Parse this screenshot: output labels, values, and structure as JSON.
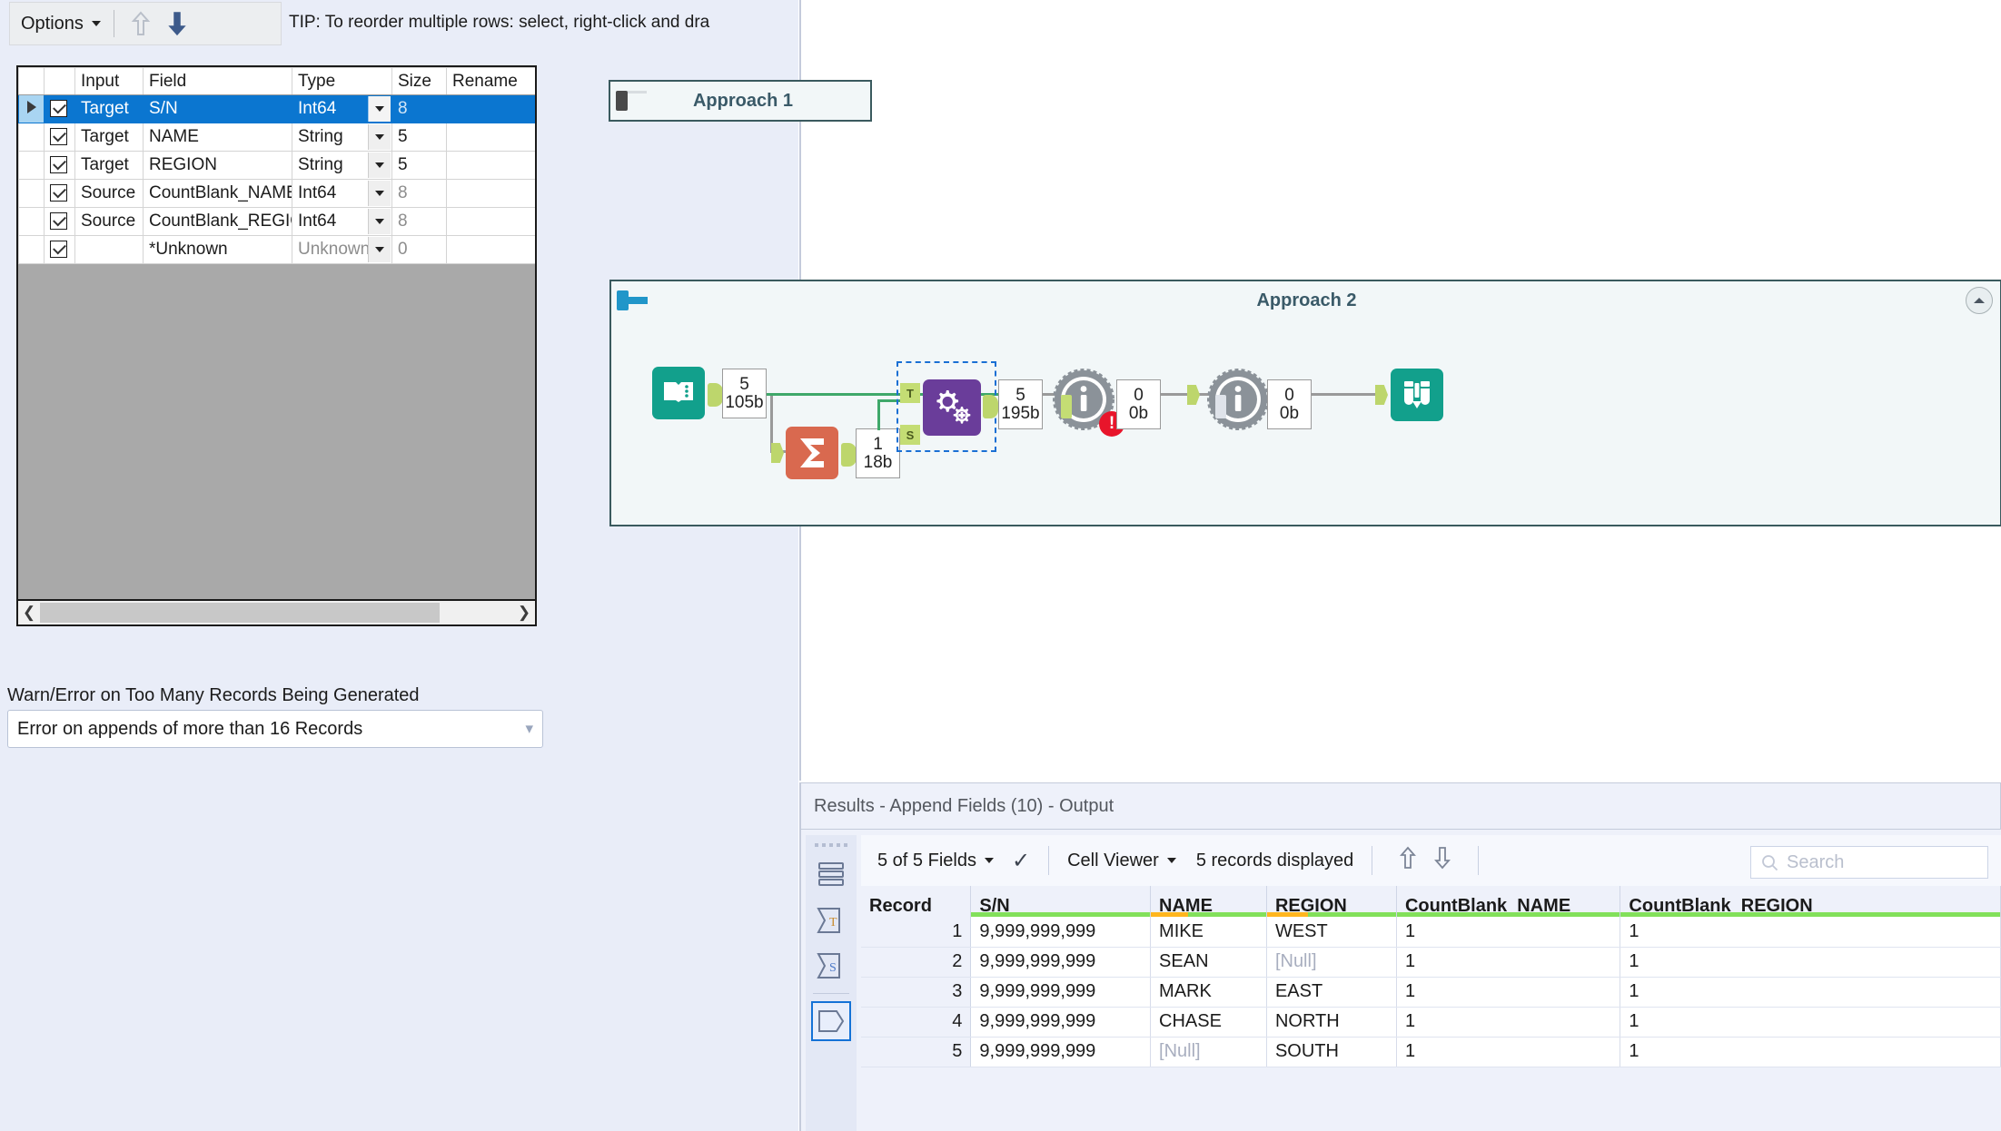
{
  "config_panel": {
    "toolbar": {
      "options_label": "Options",
      "move_up_icon": "arrow-up-icon",
      "move_down_icon": "arrow-down-icon",
      "tip": "TIP: To reorder multiple rows: select, right-click and dra"
    },
    "grid": {
      "columns": [
        "Input",
        "Field",
        "Type",
        "Size",
        "Rename"
      ],
      "rows": [
        {
          "selected": true,
          "checked": true,
          "input": "Target",
          "field": "S/N",
          "type": "Int64",
          "type_dim": false,
          "size": "8",
          "size_dim": true,
          "rename": ""
        },
        {
          "selected": false,
          "checked": true,
          "input": "Target",
          "field": "NAME",
          "type": "String",
          "type_dim": false,
          "size": "5",
          "size_dim": false,
          "rename": ""
        },
        {
          "selected": false,
          "checked": true,
          "input": "Target",
          "field": "REGION",
          "type": "String",
          "type_dim": false,
          "size": "5",
          "size_dim": false,
          "rename": ""
        },
        {
          "selected": false,
          "checked": true,
          "input": "Source",
          "field": "CountBlank_NAME",
          "type": "Int64",
          "type_dim": false,
          "size": "8",
          "size_dim": true,
          "rename": ""
        },
        {
          "selected": false,
          "checked": true,
          "input": "Source",
          "field": "CountBlank_REGION",
          "type": "Int64",
          "type_dim": false,
          "size": "8",
          "size_dim": true,
          "rename": ""
        },
        {
          "selected": false,
          "checked": true,
          "input": "",
          "field": "*Unknown",
          "type": "Unknown",
          "type_dim": true,
          "size": "0",
          "size_dim": true,
          "rename": ""
        }
      ]
    },
    "warn": {
      "label": "Warn/Error on Too Many Records Being Generated",
      "value": "Error on appends of more than 16 Records"
    }
  },
  "canvas": {
    "containers": [
      {
        "name": "Approach 1",
        "collapsed": true
      },
      {
        "name": "Approach 2",
        "collapsed": false
      }
    ],
    "tools": [
      {
        "name": "input-data-tool",
        "icon": "book-icon"
      },
      {
        "name": "summarize-tool",
        "icon": "sigma-icon"
      },
      {
        "name": "append-fields-tool",
        "icon": "gears-icon",
        "selected": true,
        "anchors": [
          "T",
          "S"
        ]
      },
      {
        "name": "select-tool-1",
        "icon": "info-gear-icon",
        "error": true
      },
      {
        "name": "select-tool-2",
        "icon": "info-gear-icon",
        "error": false
      },
      {
        "name": "browse-tool",
        "icon": "binoculars-icon"
      }
    ],
    "counts": [
      {
        "records": "5",
        "size": "105b"
      },
      {
        "records": "1",
        "size": "18b"
      },
      {
        "records": "5",
        "size": "195b"
      },
      {
        "records": "0",
        "size": "0b"
      },
      {
        "records": "0",
        "size": "0b"
      }
    ]
  },
  "results": {
    "title": "Results - Append Fields (10) - Output",
    "toolbar": {
      "fields_label": "5 of 5 Fields",
      "check_icon": "checkmark-icon",
      "viewer_label": "Cell Viewer",
      "records_label": "5 records displayed",
      "up_icon": "arrow-up-icon",
      "down_icon": "arrow-down-icon",
      "search_placeholder": "Search",
      "search_icon": "search-icon"
    },
    "sidebar_icons": [
      "data-view-icon",
      "metadata-t-icon",
      "metadata-s-icon",
      "output-anchor-icon"
    ],
    "table": {
      "columns": [
        {
          "label": "Record",
          "bar": "none"
        },
        {
          "label": "S/N",
          "bar": "green"
        },
        {
          "label": "NAME",
          "bar": "partial"
        },
        {
          "label": "REGION",
          "bar": "partial"
        },
        {
          "label": "CountBlank_NAME",
          "bar": "green"
        },
        {
          "label": "CountBlank_REGION",
          "bar": "green"
        }
      ],
      "rows": [
        {
          "record": "1",
          "sn": "9,999,999,999",
          "name": "MIKE",
          "name_null": false,
          "region": "WEST",
          "region_null": false,
          "cb_name": "1",
          "cb_region": "1"
        },
        {
          "record": "2",
          "sn": "9,999,999,999",
          "name": "SEAN",
          "name_null": false,
          "region": "[Null]",
          "region_null": true,
          "cb_name": "1",
          "cb_region": "1"
        },
        {
          "record": "3",
          "sn": "9,999,999,999",
          "name": "MARK",
          "name_null": false,
          "region": "EAST",
          "region_null": false,
          "cb_name": "1",
          "cb_region": "1"
        },
        {
          "record": "4",
          "sn": "9,999,999,999",
          "name": "CHASE",
          "name_null": false,
          "region": "NORTH",
          "region_null": false,
          "cb_name": "1",
          "cb_region": "1"
        },
        {
          "record": "5",
          "sn": "9,999,999,999",
          "name": "[Null]",
          "name_null": true,
          "region": "SOUTH",
          "region_null": false,
          "cb_name": "1",
          "cb_region": "1"
        }
      ]
    }
  },
  "colors": {
    "selection_blue": "#0b76d0",
    "teal": "#12a08c",
    "purple": "#6a3d9a",
    "orange": "#d9694f",
    "error_red": "#e8152b",
    "anchor_green": "#bdd66c",
    "bar_green": "#82e05a",
    "bar_orange": "#ffb61e"
  }
}
